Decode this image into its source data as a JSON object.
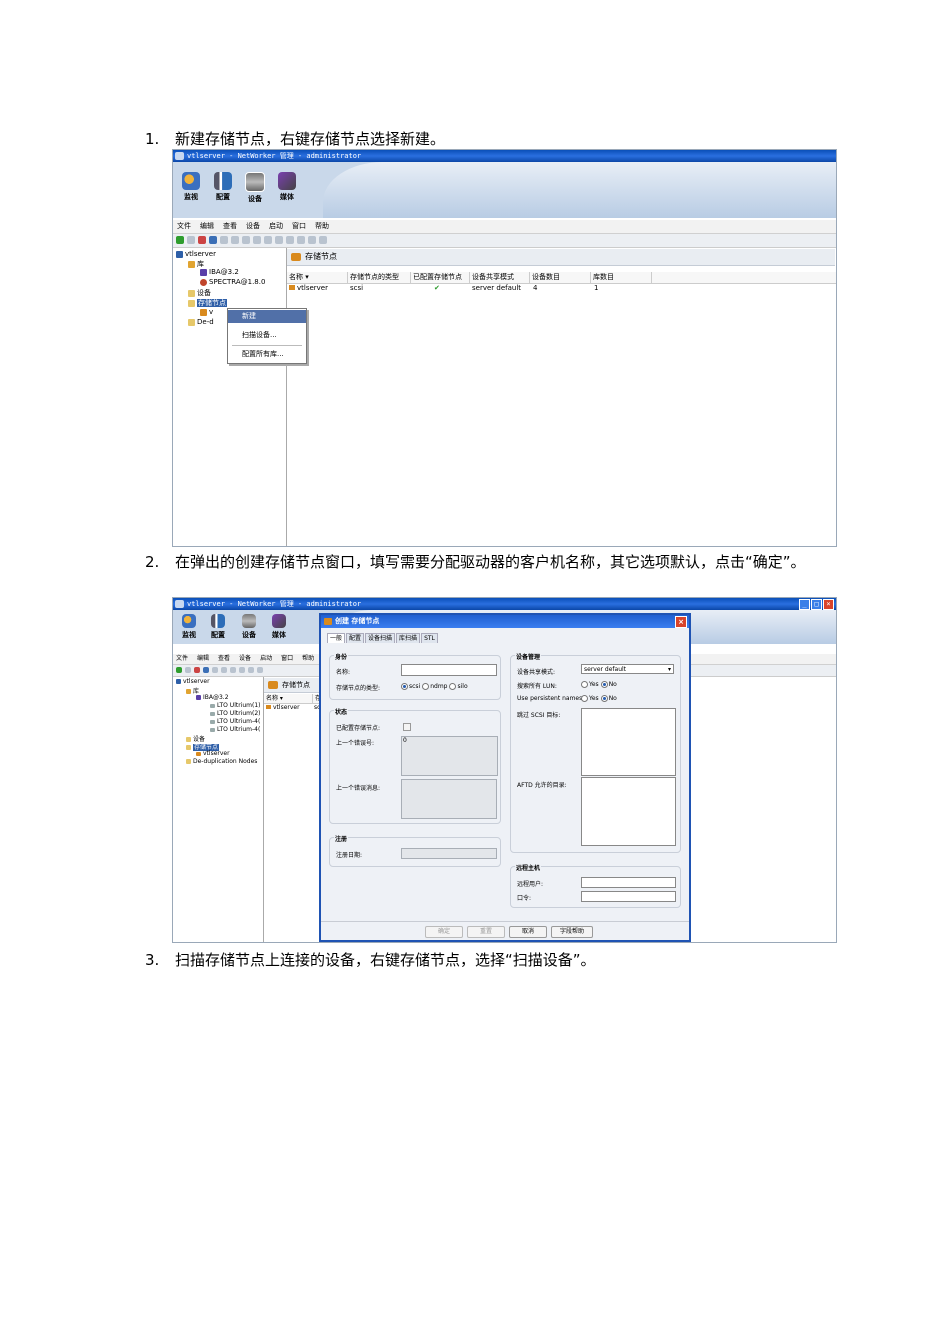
{
  "steps": [
    {
      "num": "1.",
      "text": "新建存储节点，右键存储节点选择新建。"
    },
    {
      "num": "2.",
      "text": "在弹出的创建存储节点窗口，填写需要分配驱动器的客户机名称，其它选项默认，点击“确定”。"
    },
    {
      "num": "3.",
      "text": "扫描存储节点上连接的设备，右键存储节点，选择“扫描设备”。"
    }
  ],
  "window": {
    "title": "vtlserver - NetWorker 管理 - administrator",
    "toolbar": [
      "监视",
      "配置",
      "设备",
      "媒体"
    ],
    "menu": [
      "文件",
      "编辑",
      "查看",
      "设备",
      "启动",
      "窗口",
      "帮助"
    ]
  },
  "shot1": {
    "tree": {
      "root": "vtlserver",
      "library": "库",
      "lib1": "IBA@3.2",
      "lib2": "SPECTRA@1.8.0",
      "devices": "设备",
      "storage_nodes": "存储节点",
      "sn_child": "v",
      "dedup": "De-d"
    },
    "pane_title": "存储节点",
    "columns": [
      "名称 ▾",
      "存储节点的类型",
      "已配置存储节点",
      "设备共享模式",
      "设备数目",
      "库数目"
    ],
    "row": {
      "name": "vtlserver",
      "type": "scsi",
      "configured": "✔",
      "share_mode": "server default",
      "devices": "4",
      "libraries": "1"
    },
    "context_menu": [
      "新建",
      "扫描设备...",
      "配置所有库..."
    ]
  },
  "shot2": {
    "tree": {
      "root": "vtlserver",
      "library": "库",
      "lib1": "IBA@3.2",
      "drives": [
        "LTO Ultrium(1)",
        "LTO Ultrium(2)",
        "LTO Ultrium-4(",
        "LTO Ultrium-4("
      ],
      "devices": "设备",
      "storage_nodes": "存储节点",
      "sn_child": "vtlserver",
      "dedup": "De-duplication Nodes"
    },
    "pane_title": "存储节点",
    "col_name": "名称 ▾",
    "col_cut": "存",
    "row_name": "vtlserver",
    "row_cut": "sc",
    "dialog": {
      "title": "创建 存储节点",
      "tabs": [
        "一般",
        "配置",
        "设备扫描",
        "库扫描",
        "STL"
      ],
      "identity": {
        "title": "身份",
        "name_label": "名称:",
        "name_value": "",
        "type_label": "存储节点的类型:",
        "type_options": [
          "scsi",
          "ndmp",
          "silo"
        ],
        "type_selected": "scsi"
      },
      "status": {
        "title": "状态",
        "configured_label": "已配置存储节点:",
        "last_error_label": "上一个错误号:",
        "last_error_value": "0",
        "last_error_msg_label": "上一个错误消息:"
      },
      "registration": {
        "title": "注册",
        "date_label": "注册日期:"
      },
      "device_mgmt": {
        "title": "设备管理",
        "share_label": "设备共享模式:",
        "share_value": "server default",
        "search_lun_label": "搜索所有 LUN:",
        "persistent_label": "Use persistent names:",
        "yes": "Yes",
        "no": "No",
        "skip_scsi_label": "跳过 SCSI 目标:",
        "aftd_label": "AFTD 允许的目录:"
      },
      "remote": {
        "title": "远程主机",
        "user_label": "远程用户:",
        "password_label": "口令:"
      },
      "buttons": [
        "确定",
        "重置",
        "取消",
        "字段帮助"
      ]
    }
  }
}
